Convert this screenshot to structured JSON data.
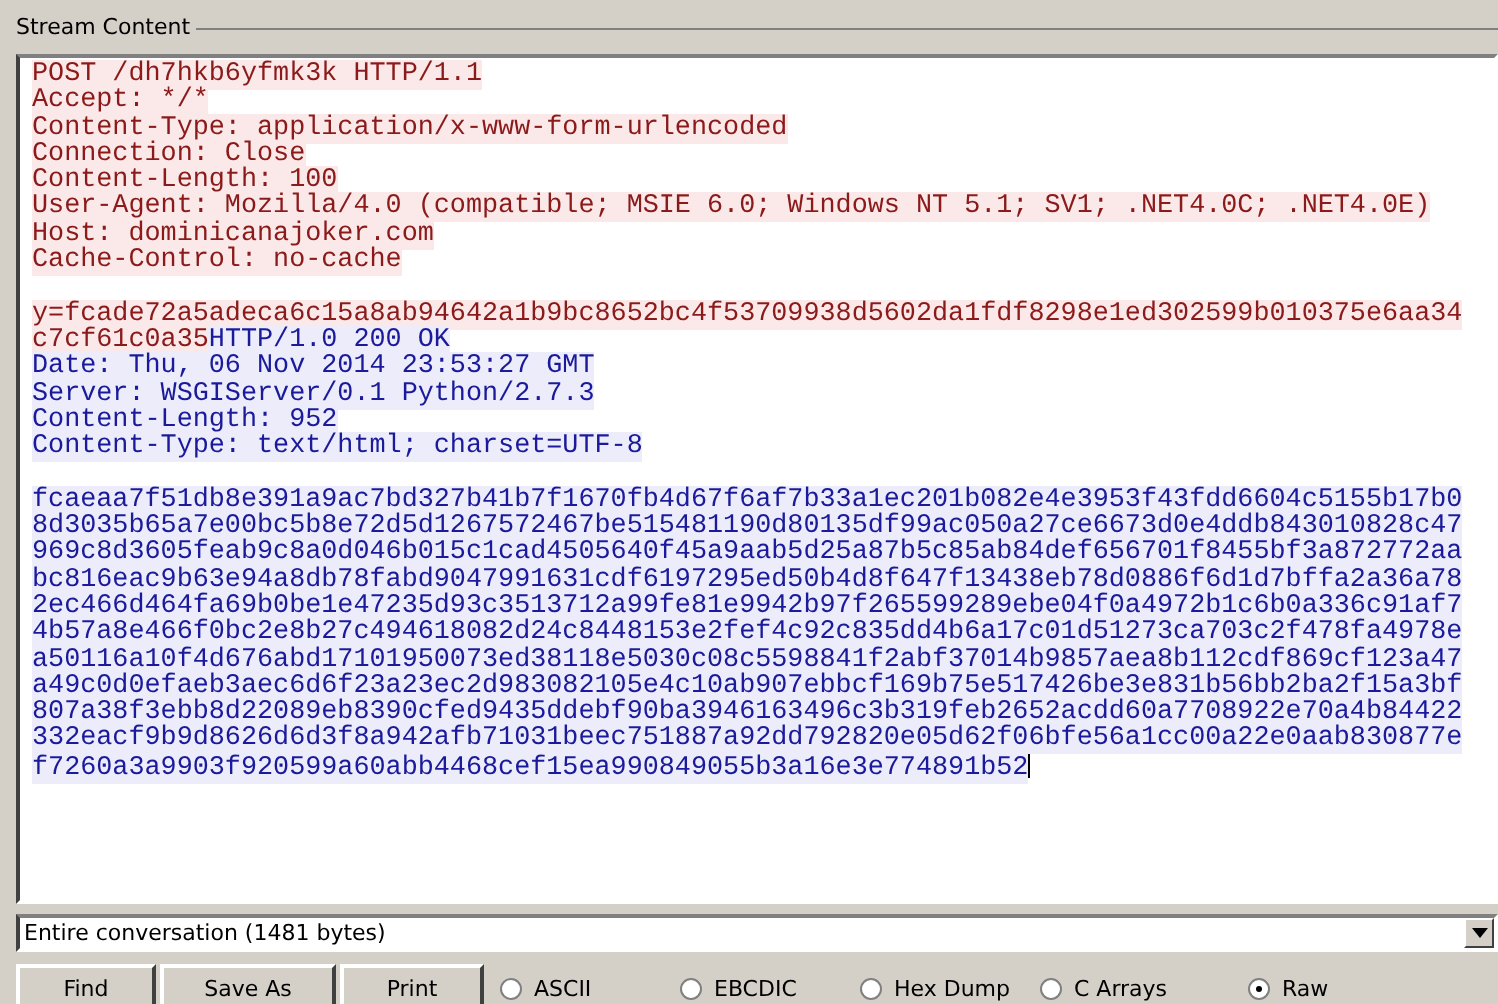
{
  "group_title": "Stream Content",
  "stream": [
    {
      "blank_before": false,
      "segments": [
        {
          "kind": "client",
          "text": "POST /dh7hkb6yfmk3k HTTP/1.1"
        }
      ]
    },
    {
      "blank_before": false,
      "segments": [
        {
          "kind": "client",
          "text": "Accept: */*"
        }
      ]
    },
    {
      "blank_before": false,
      "segments": [
        {
          "kind": "client",
          "text": "Content-Type: application/x-www-form-urlencoded"
        }
      ]
    },
    {
      "blank_before": false,
      "segments": [
        {
          "kind": "client",
          "text": "Connection: Close"
        }
      ]
    },
    {
      "blank_before": false,
      "segments": [
        {
          "kind": "client",
          "text": "Content-Length: 100"
        }
      ]
    },
    {
      "blank_before": false,
      "segments": [
        {
          "kind": "client",
          "text": "User-Agent: Mozilla/4.0 (compatible; MSIE 6.0; Windows NT 5.1; SV1; .NET4.0C; .NET4.0E)"
        }
      ]
    },
    {
      "blank_before": false,
      "segments": [
        {
          "kind": "client",
          "text": "Host: dominicanajoker.com"
        }
      ]
    },
    {
      "blank_before": false,
      "segments": [
        {
          "kind": "client",
          "text": "Cache-Control: no-cache"
        }
      ]
    },
    {
      "blank_before": true,
      "segments": [
        {
          "kind": "client",
          "text": "y=fcade72a5adeca6c15a8ab94642a1b9bc8652bc4f53709938d5602da1fdf8298e1ed302599b010375e6aa34"
        }
      ]
    },
    {
      "blank_before": false,
      "segments": [
        {
          "kind": "client",
          "text": "c7cf61c0a35"
        },
        {
          "kind": "server",
          "text": "HTTP/1.0 200 OK"
        }
      ]
    },
    {
      "blank_before": false,
      "segments": [
        {
          "kind": "server",
          "text": "Date: Thu, 06 Nov 2014 23:53:27 GMT"
        }
      ]
    },
    {
      "blank_before": false,
      "segments": [
        {
          "kind": "server",
          "text": "Server: WSGIServer/0.1 Python/2.7.3"
        }
      ]
    },
    {
      "blank_before": false,
      "segments": [
        {
          "kind": "server",
          "text": "Content-Length: 952"
        }
      ]
    },
    {
      "blank_before": false,
      "segments": [
        {
          "kind": "server",
          "text": "Content-Type: text/html; charset=UTF-8"
        }
      ]
    },
    {
      "blank_before": true,
      "segments": [
        {
          "kind": "server",
          "text": "fcaeaa7f51db8e391a9ac7bd327b41b7f1670fb4d67f6af7b33a1ec201b082e4e3953f43fdd6604c5155b17b0"
        }
      ]
    },
    {
      "blank_before": false,
      "segments": [
        {
          "kind": "server",
          "text": "8d3035b65a7e00bc5b8e72d5d1267572467be515481190d80135df99ac050a27ce6673d0e4ddb843010828c47"
        }
      ]
    },
    {
      "blank_before": false,
      "segments": [
        {
          "kind": "server",
          "text": "969c8d3605feab9c8a0d046b015c1cad4505640f45a9aab5d25a87b5c85ab84def656701f8455bf3a872772aa"
        }
      ]
    },
    {
      "blank_before": false,
      "segments": [
        {
          "kind": "server",
          "text": "bc816eac9b63e94a8db78fabd9047991631cdf6197295ed50b4d8f647f13438eb78d0886f6d1d7bffa2a36a78"
        }
      ]
    },
    {
      "blank_before": false,
      "segments": [
        {
          "kind": "server",
          "text": "2ec466d464fa69b0be1e47235d93c3513712a99fe81e9942b97f265599289ebe04f0a4972b1c6b0a336c91af7"
        }
      ]
    },
    {
      "blank_before": false,
      "segments": [
        {
          "kind": "server",
          "text": "4b57a8e466f0bc2e8b27c494618082d24c8448153e2fef4c92c835dd4b6a17c01d51273ca703c2f478fa4978e"
        }
      ]
    },
    {
      "blank_before": false,
      "segments": [
        {
          "kind": "server",
          "text": "a50116a10f4d676abd17101950073ed38118e5030c08c5598841f2abf37014b9857aea8b112cdf869cf123a47"
        }
      ]
    },
    {
      "blank_before": false,
      "segments": [
        {
          "kind": "server",
          "text": "a49c0d0efaeb3aec6d6f23a23ec2d983082105e4c10ab907ebbcf169b75e517426be3e831b56bb2ba2f15a3bf"
        }
      ]
    },
    {
      "blank_before": false,
      "segments": [
        {
          "kind": "server",
          "text": "807a38f3ebb8d22089eb8390cfed9435ddebf90ba3946163496c3b319feb2652acdd60a7708922e70a4b84422"
        }
      ]
    },
    {
      "blank_before": false,
      "segments": [
        {
          "kind": "server",
          "text": "332eacf9b9d8626d6d3f8a942afb71031beec751887a92dd792820e05d62f06bfe56a1cc00a22e0aab830877e"
        }
      ]
    },
    {
      "blank_before": false,
      "segments": [
        {
          "kind": "server",
          "text": "f7260a3a9903f920599a60abb4468cef15ea990849055b3a16e3e774891b52"
        }
      ]
    }
  ],
  "conversation_select": {
    "value": "Entire conversation (1481 bytes)"
  },
  "buttons": [
    "Find",
    "Save As",
    "Print"
  ],
  "formats": [
    {
      "label": "ASCII",
      "selected": false
    },
    {
      "label": "EBCDIC",
      "selected": false
    },
    {
      "label": "Hex Dump",
      "selected": false
    },
    {
      "label": "C Arrays",
      "selected": false
    },
    {
      "label": "Raw",
      "selected": true
    }
  ]
}
